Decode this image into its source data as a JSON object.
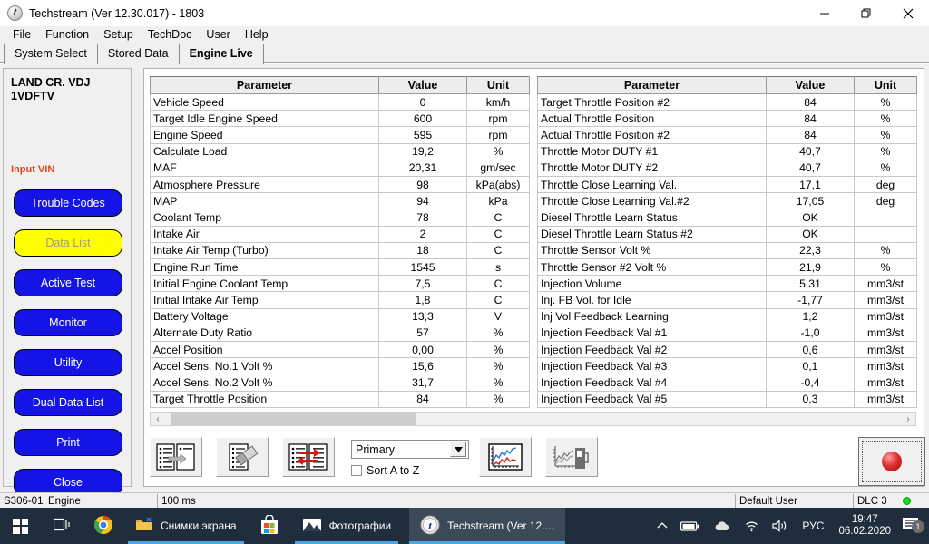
{
  "window": {
    "title": "Techstream (Ver 12.30.017) - 1803",
    "app_icon": "techstream-icon",
    "minimize_label": "—",
    "restore_label": "restore-icon",
    "close_label": "✕"
  },
  "menubar": {
    "items": [
      "File",
      "Function",
      "Setup",
      "TechDoc",
      "User",
      "Help"
    ]
  },
  "tabs": [
    {
      "label": "System Select",
      "active": false
    },
    {
      "label": "Stored Data",
      "active": false
    },
    {
      "label": "Engine Live",
      "active": true
    }
  ],
  "sidebar": {
    "vehicle_line1": "LAND CR. VDJ",
    "vehicle_line2": "1VDFTV",
    "vehicle_name": "LAND CR. VDJ\n1VDFTV",
    "input_vin": "Input VIN",
    "input_vin_color": "#e8401c",
    "button_color": "#1414e6",
    "active_button_color": "#ffff00",
    "buttons": [
      {
        "label": "Trouble Codes",
        "active": false
      },
      {
        "label": "Data List",
        "active": true
      },
      {
        "label": "Active Test",
        "active": false
      },
      {
        "label": "Monitor",
        "active": false
      },
      {
        "label": "Utility",
        "active": false
      },
      {
        "label": "Dual Data List",
        "active": false
      },
      {
        "label": "Print",
        "active": false
      },
      {
        "label": "Close",
        "active": false
      }
    ]
  },
  "table": {
    "headers": [
      "Parameter",
      "Value",
      "Unit"
    ],
    "left_rows": [
      [
        "Vehicle Speed",
        "0",
        "km/h"
      ],
      [
        "Target Idle Engine Speed",
        "600",
        "rpm"
      ],
      [
        "Engine Speed",
        "595",
        "rpm"
      ],
      [
        "Calculate Load",
        "19,2",
        "%"
      ],
      [
        "MAF",
        "20,31",
        "gm/sec"
      ],
      [
        "Atmosphere Pressure",
        "98",
        "kPa(abs)"
      ],
      [
        "MAP",
        "94",
        "kPa"
      ],
      [
        "Coolant Temp",
        "78",
        "C"
      ],
      [
        "Intake Air",
        "2",
        "C"
      ],
      [
        "Intake Air Temp (Turbo)",
        "18",
        "C"
      ],
      [
        "Engine Run Time",
        "1545",
        "s"
      ],
      [
        "Initial Engine Coolant Temp",
        "7,5",
        "C"
      ],
      [
        "Initial Intake Air Temp",
        "1,8",
        "C"
      ],
      [
        "Battery Voltage",
        "13,3",
        "V"
      ],
      [
        "Alternate Duty Ratio",
        "57",
        "%"
      ],
      [
        "Accel Position",
        "0,00",
        "%"
      ],
      [
        "Accel Sens. No.1 Volt %",
        "15,6",
        "%"
      ],
      [
        "Accel Sens. No.2 Volt %",
        "31,7",
        "%"
      ],
      [
        "Target Throttle Position",
        "84",
        "%"
      ]
    ],
    "right_rows": [
      [
        "Target Throttle Position #2",
        "84",
        "%"
      ],
      [
        "Actual Throttle Position",
        "84",
        "%"
      ],
      [
        "Actual Throttle Position #2",
        "84",
        "%"
      ],
      [
        "Throttle Motor DUTY #1",
        "40,7",
        "%"
      ],
      [
        "Throttle Motor DUTY #2",
        "40,7",
        "%"
      ],
      [
        "Throttle Close Learning Val.",
        "17,1",
        "deg"
      ],
      [
        "Throttle Close Learning Val.#2",
        "17,05",
        "deg"
      ],
      [
        "Diesel Throttle Learn Status",
        "OK",
        ""
      ],
      [
        "Diesel Throttle Learn Status #2",
        "OK",
        ""
      ],
      [
        "Throttle Sensor Volt %",
        "22,3",
        "%"
      ],
      [
        "Throttle Sensor #2 Volt %",
        "21,9",
        "%"
      ],
      [
        "Injection Volume",
        "5,31",
        "mm3/st"
      ],
      [
        "Inj. FB Vol. for Idle",
        "-1,77",
        "mm3/st"
      ],
      [
        "Inj Vol Feedback Learning",
        "1,2",
        "mm3/st"
      ],
      [
        "Injection Feedback Val #1",
        "-1,0",
        "mm3/st"
      ],
      [
        "Injection Feedback Val #2",
        "0,6",
        "mm3/st"
      ],
      [
        "Injection Feedback Val #3",
        "0,1",
        "mm3/st"
      ],
      [
        "Injection Feedback Val #4",
        "-0,4",
        "mm3/st"
      ],
      [
        "Injection Feedback Val #5",
        "0,3",
        "mm3/st"
      ]
    ]
  },
  "scrollbar": {
    "left_arrow": "‹",
    "right_arrow": "›"
  },
  "toolbar": {
    "buttons": [
      {
        "name": "move-selected-icon",
        "tooltip": ""
      },
      {
        "name": "erase-list-icon",
        "tooltip": ""
      },
      {
        "name": "swap-list-icon",
        "tooltip": ""
      },
      {
        "name": "graph-view-icon",
        "tooltip": ""
      },
      {
        "name": "fuel-graph-icon",
        "tooltip": ""
      }
    ],
    "combo_value": "Primary",
    "combo_arrow": "▼",
    "checkbox_label": "Sort A to Z",
    "checkbox_checked": false,
    "record_button": "record-button"
  },
  "statusbar": {
    "code": "S306-01",
    "system": "Engine",
    "interval": "100 ms",
    "user": "Default User",
    "dlc": "DLC 3",
    "dlc_status_color": "#12e012"
  },
  "taskbar": {
    "start": "start-button",
    "taskview": "task-view-button",
    "items": [
      {
        "icon": "chrome-icon",
        "label": ""
      },
      {
        "icon": "folder-icon",
        "label": "Снимки экрана"
      },
      {
        "icon": "microsoft-store-icon",
        "label": ""
      },
      {
        "icon": "photos-icon",
        "label": "Фотографии"
      },
      {
        "icon": "techstream-icon",
        "label": "Techstream (Ver 12...."
      }
    ],
    "tray": {
      "chevron": "⌃",
      "battery": "battery-icon",
      "onedrive": "cloud-icon",
      "wifi": "wifi-icon",
      "volume": "speaker-icon",
      "language": "РУС",
      "time": "19:47",
      "date": "06.02.2020",
      "notification_count": "1"
    }
  }
}
